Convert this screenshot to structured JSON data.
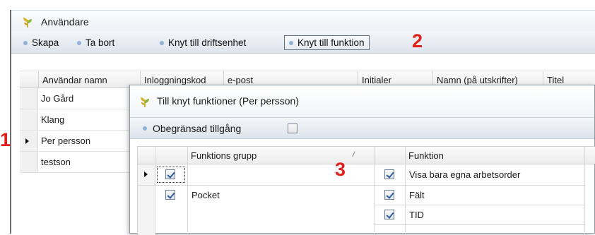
{
  "window": {
    "title": "Användare"
  },
  "toolbar": {
    "create_label": "Skapa",
    "delete_label": "Ta bort",
    "link_unit_label": "Knyt till driftsenhet",
    "link_function_label": "Knyt till funktion"
  },
  "callouts": {
    "one": "1",
    "two": "2",
    "three": "3"
  },
  "users_grid": {
    "columns": [
      "Användar namn",
      "Inloggningskod",
      "e-post",
      "Initialer",
      "Namn (på utskrifter)",
      "Titel"
    ],
    "rows": [
      "Jo Gård",
      "Klang",
      "Per persson",
      "testson"
    ],
    "selected_row": "Per persson"
  },
  "dialog": {
    "title": "Till knyt funktioner (Per persson)",
    "unrestricted_label": "Obegränsad tillgång",
    "unrestricted_checked": false,
    "columns": {
      "group": "Funktions grupp",
      "function": "Funktion"
    },
    "groups": [
      {
        "name": "",
        "checked": true,
        "current": true
      },
      {
        "name": "Pocket",
        "checked": true,
        "current": false
      }
    ],
    "functions": [
      {
        "name": "Visa bara egna arbetsorder",
        "checked": true
      },
      {
        "name": "Fält",
        "checked": true
      },
      {
        "name": "TID",
        "checked": true
      }
    ]
  },
  "colors": {
    "callout": "#e0201a",
    "toolbar_dot": "#8fb2d6"
  }
}
